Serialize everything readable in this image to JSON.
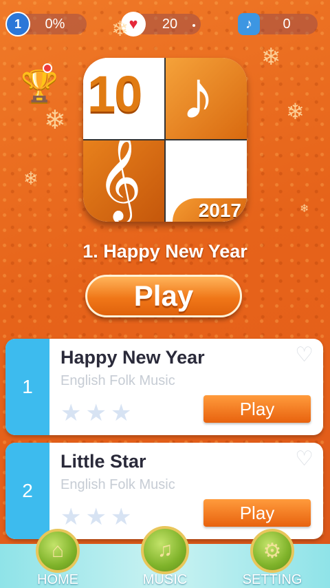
{
  "stats": {
    "level": "1",
    "progress": "0%",
    "hearts": "20",
    "notes": "0"
  },
  "icons": {
    "level": "level-badge-icon",
    "heart": "heart-icon",
    "note": "music-note-icon",
    "trophy": "trophy-icon",
    "snowflake": "snowflake-icon"
  },
  "logo": {
    "number": "10",
    "year": "2017"
  },
  "featured": {
    "title": "1. Happy New Year",
    "play_label": "Play"
  },
  "songs": [
    {
      "index": "1",
      "name": "Happy New Year",
      "artist": "English Folk Music",
      "stars": 0,
      "play_label": "Play"
    },
    {
      "index": "2",
      "name": "Little Star",
      "artist": "English Folk Music",
      "stars": 0,
      "play_label": "Play"
    }
  ],
  "nav": {
    "home": "HOME",
    "music": "MUSIC",
    "setting": "SETTING"
  },
  "colors": {
    "background": "#e6631a",
    "accent_blue": "#3dbbee",
    "play_orange": "#f07718"
  }
}
